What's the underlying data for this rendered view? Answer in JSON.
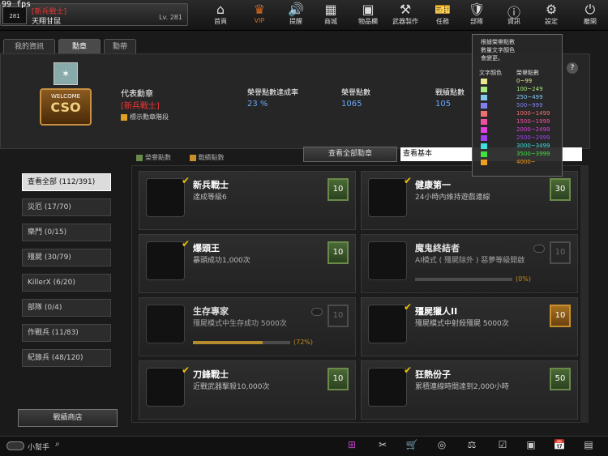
{
  "fps": "99 fps",
  "player": {
    "rank": "281",
    "title": "[新兵戰士]",
    "name": "天翔甘鼠",
    "level": "Lv. 281"
  },
  "nav": [
    {
      "label": "首頁",
      "icon": "home-icon"
    },
    {
      "label": "VIP",
      "icon": "crown-icon"
    },
    {
      "label": "提醒",
      "icon": "speaker-icon"
    },
    {
      "label": "商城",
      "icon": "store-icon"
    },
    {
      "label": "物品欄",
      "icon": "bag-icon"
    },
    {
      "label": "武器製作",
      "icon": "weapon-icon"
    },
    {
      "label": "任務",
      "icon": "ticket-icon"
    },
    {
      "label": "部隊",
      "icon": "clan-icon"
    },
    {
      "label": "資訊",
      "icon": "info-icon"
    },
    {
      "label": "設定",
      "icon": "gear-icon"
    },
    {
      "label": "離開",
      "icon": "power-icon"
    }
  ],
  "tabs": [
    "我的資訊",
    "勳章",
    "勳帶"
  ],
  "header": {
    "medal_logo_top": "WELCOME",
    "medal_logo_bottom": "CSO",
    "rep_label": "代表勳章",
    "rep_value": "[新兵戰士]",
    "show_grade": "標示勳章階段",
    "rate_label": "榮譽點數達成率",
    "rate_value": "23 %",
    "honor_label": "榮譽點數",
    "honor_value": "1065",
    "battle_label": "戰績點數",
    "battle_value": "105"
  },
  "legend": {
    "honor": "榮譽點數",
    "battle": "戰績點數"
  },
  "view_all": "查看全部勳章",
  "view_basic": "查看基本",
  "sidebar": [
    {
      "label": "查看全部 (112/391)",
      "active": true
    },
    {
      "label": "災厄 (17/70)"
    },
    {
      "label": "樂門 (0/15)"
    },
    {
      "label": "殭屍 (30/79)"
    },
    {
      "label": "KillerX (6/20)"
    },
    {
      "label": "部隊 (0/4)"
    },
    {
      "label": "作戰兵 (11/83)"
    },
    {
      "label": "紀錄兵 (48/120)"
    }
  ],
  "shop": "戰績商店",
  "cards": [
    {
      "name": "新兵戰士",
      "desc": "達成等級6",
      "pts": "10",
      "done": true
    },
    {
      "name": "健康第一",
      "desc": "24小時內維持遊戲連線",
      "pts": "30",
      "done": true
    },
    {
      "name": "爆頭王",
      "desc": "暴頭成功1,000次",
      "pts": "10",
      "done": true
    },
    {
      "name": "魔鬼終結者",
      "desc": "AI模式 ( 殭屍除外 ) 惡夢等級開啟",
      "pts": "10",
      "done": false,
      "progress": 0,
      "pct": "(0%)"
    },
    {
      "name": "生存專家",
      "desc": "殭屍模式中生存成功 5000次",
      "pts": "10",
      "done": false,
      "progress": 72,
      "pct": "(72%)"
    },
    {
      "name": "殭屍獵人II",
      "desc": "殭屍模式中射殺殭屍 5000次",
      "pts": "10",
      "done": true,
      "gold": true
    },
    {
      "name": "刀鋒戰士",
      "desc": "近戰武器擊殺10,000次",
      "pts": "10",
      "done": true
    },
    {
      "name": "狂熱份子",
      "desc": "累積連線時間達到2,000小時",
      "pts": "50",
      "done": true
    }
  ],
  "tooltip": {
    "line1": "根據榮譽點數",
    "line2": "數量文字顏色",
    "line3": "會變更。",
    "col1": "文字顏色",
    "col2": "榮譽點數",
    "rows": [
      {
        "range": "0~99",
        "color": "#e8e890"
      },
      {
        "range": "100~249",
        "color": "#a8e880"
      },
      {
        "range": "250~499",
        "color": "#80c8f0"
      },
      {
        "range": "500~999",
        "color": "#8080f0"
      },
      {
        "range": "1000~1499",
        "color": "#f07070"
      },
      {
        "range": "1500~1999",
        "color": "#f050a0"
      },
      {
        "range": "2000~2499",
        "color": "#e040e0"
      },
      {
        "range": "2500~2999",
        "color": "#a040f0"
      },
      {
        "range": "3000~3499",
        "color": "#40e0e0"
      },
      {
        "range": "3500~3999",
        "color": "#40e040"
      },
      {
        "range": "4000~",
        "color": "#f0a020"
      }
    ]
  },
  "helper": "小幫手",
  "help": "?"
}
